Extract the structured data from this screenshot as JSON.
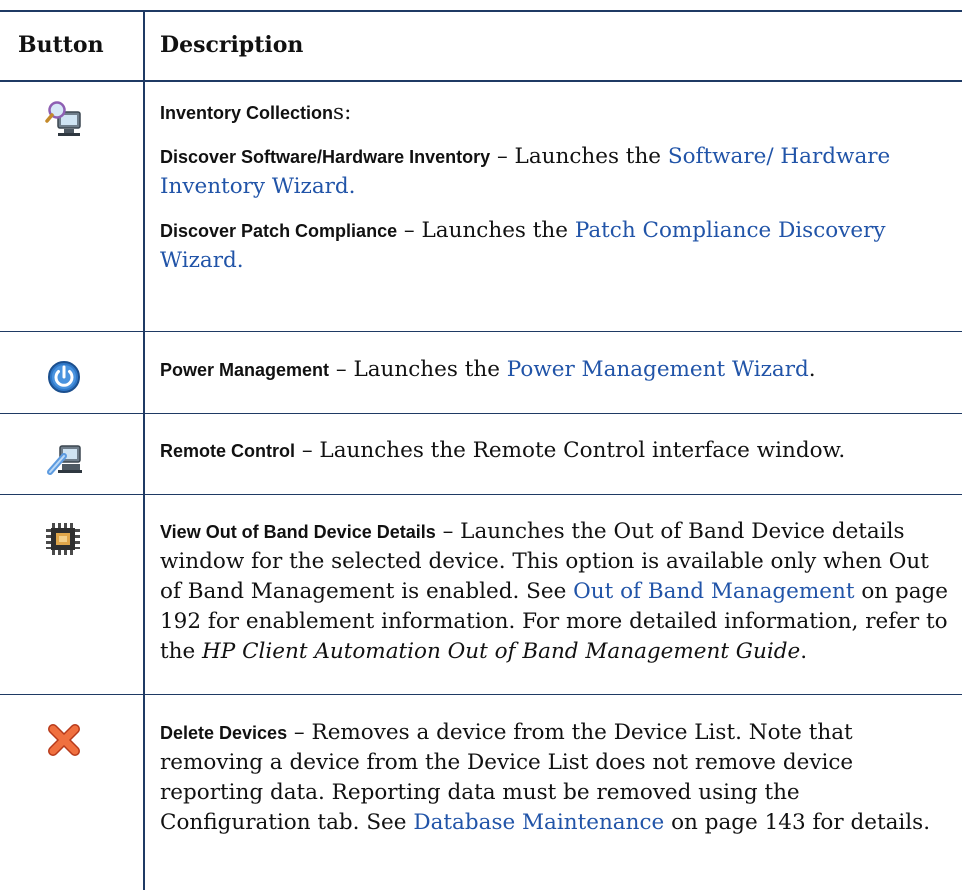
{
  "header": {
    "button": "Button",
    "description": "Description"
  },
  "rows": [
    {
      "icon": "inventory-collections-icon",
      "paras": [
        {
          "bold": "Inventory Collection",
          "after": "s:"
        },
        {
          "bold": "Discover Software/Hardware Inventory",
          "text": " – Launches the ",
          "link": "Software/ Hardware Inventory Wizard."
        },
        {
          "bold": "Discover Patch Compliance",
          "text": " – Launches the ",
          "link": "Patch Compliance Discovery Wizard."
        }
      ]
    },
    {
      "icon": "power-management-icon",
      "bold": "Power Management",
      "text": " – Launches the ",
      "link": "Power Management Wizard",
      "after": "."
    },
    {
      "icon": "remote-control-icon",
      "bold": "Remote Control",
      "text": " – Launches the Remote Control interface window."
    },
    {
      "icon": "out-of-band-chip-icon",
      "bold": "View Out of Band Device Details",
      "text": " – Launches the Out of Band Device details window for the selected device. This option is available only when Out of Band Management is enabled. See ",
      "link": "Out of Band Management",
      "text2": " on page 192 for enablement information. For more detailed information, refer to the ",
      "italic": "HP Client Automation Out of Band Management Guide",
      "after": "."
    },
    {
      "icon": "delete-x-icon",
      "bold": "Delete Devices",
      "text": " – Removes a device from the Device List. Note that removing a device from the Device List does not remove device reporting data. Reporting data must be removed using the Configuration tab. See ",
      "link": "Database Maintenance",
      "text2": " on page 143 for details."
    }
  ]
}
